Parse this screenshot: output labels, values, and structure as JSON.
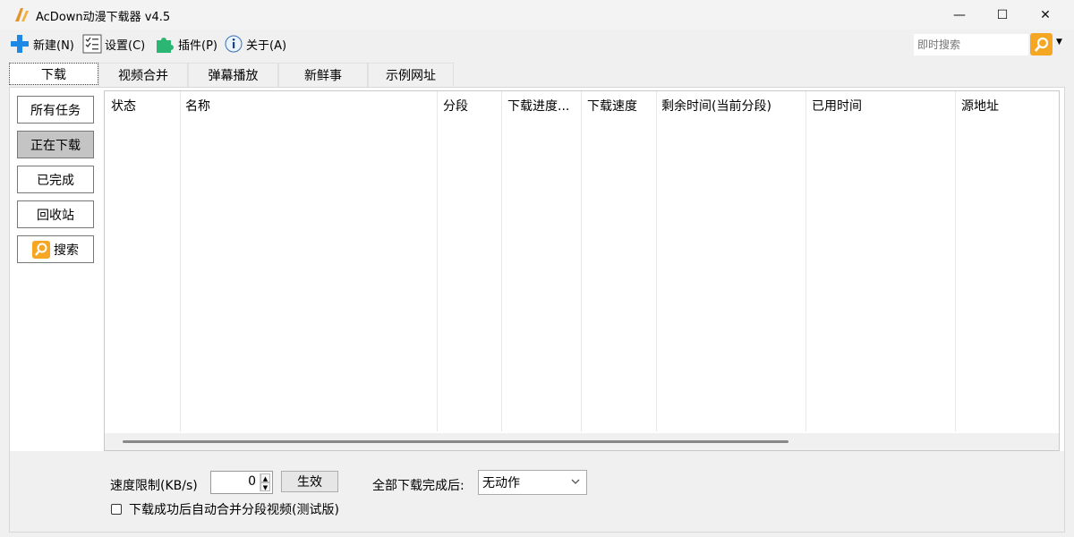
{
  "window": {
    "title": "AcDown动漫下载器 v4.5",
    "minimize": "—",
    "maximize": "☐",
    "close": "✕"
  },
  "menu": {
    "new": "新建(N)",
    "settings": "设置(C)",
    "plugins": "插件(P)",
    "about": "关于(A)",
    "search_placeholder": "即时搜索"
  },
  "tabs": [
    "下载",
    "视频合并",
    "弹幕播放",
    "新鲜事",
    "示例网址"
  ],
  "sidebar": {
    "items": [
      "所有任务",
      "正在下载",
      "已完成",
      "回收站",
      "搜索"
    ],
    "selected": "正在下载"
  },
  "table": {
    "columns": [
      "状态",
      "名称",
      "分段",
      "下载进度...",
      "下载速度",
      "剩余时间(当前分段)",
      "已用时间",
      "源地址"
    ]
  },
  "bottom": {
    "speed_label": "速度限制(KB/s)",
    "speed_value": "0",
    "apply_button": "生效",
    "after_label": "全部下载完成后:",
    "after_value": "无动作",
    "merge_checkbox_label": "下载成功后自动合并分段视频(测试版)"
  },
  "colors": {
    "accent_orange": "#f5a623",
    "plus_blue": "#1e88e5",
    "plugin_green": "#2bb673"
  }
}
